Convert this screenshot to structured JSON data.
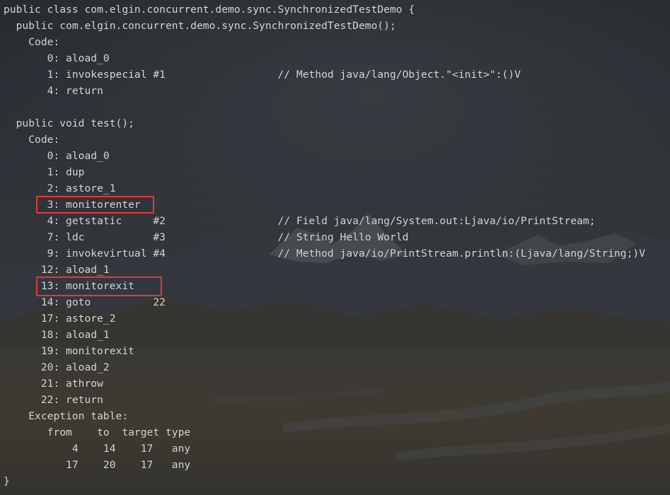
{
  "code_lines": [
    "public class com.elgin.concurrent.demo.sync.SynchronizedTestDemo {",
    "  public com.elgin.concurrent.demo.sync.SynchronizedTestDemo();",
    "    Code:",
    "       0: aload_0",
    "       1: invokespecial #1                  // Method java/lang/Object.\"<init>\":()V",
    "       4: return",
    "",
    "  public void test();",
    "    Code:",
    "       0: aload_0",
    "       1: dup",
    "       2: astore_1",
    "       3: monitorenter",
    "       4: getstatic     #2                  // Field java/lang/System.out:Ljava/io/PrintStream;",
    "       7: ldc           #3                  // String Hello World",
    "       9: invokevirtual #4                  // Method java/io/PrintStream.println:(Ljava/lang/String;)V",
    "      12: aload_1",
    "      13: monitorexit",
    "      14: goto          22",
    "      17: astore_2",
    "      18: aload_1",
    "      19: monitorexit",
    "      20: aload_2",
    "      21: athrow",
    "      22: return",
    "    Exception table:",
    "       from    to  target type",
    "           4    14    17   any",
    "          17    20    17   any",
    "}"
  ],
  "highlight_color": "#e53935",
  "text_color": "#d8d8d8"
}
